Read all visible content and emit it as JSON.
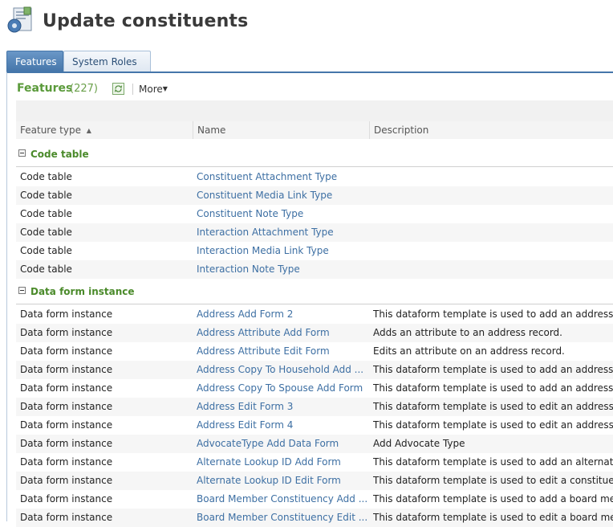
{
  "header": {
    "title": "Update constituents",
    "icon": "constituent-update-icon"
  },
  "tabs": [
    {
      "label": "Features",
      "active": true
    },
    {
      "label": "System Roles",
      "active": false
    }
  ],
  "toolbar": {
    "title": "Features",
    "count": "(227)",
    "refresh_icon": "refresh-icon",
    "more_label": "More"
  },
  "columns": {
    "type": "Feature type",
    "name": "Name",
    "description": "Description"
  },
  "groups": [
    {
      "label": "Code table",
      "rows": [
        {
          "type": "Code table",
          "name": "Constituent Attachment Type",
          "description": ""
        },
        {
          "type": "Code table",
          "name": "Constituent Media Link Type",
          "description": ""
        },
        {
          "type": "Code table",
          "name": "Constituent Note Type",
          "description": ""
        },
        {
          "type": "Code table",
          "name": "Interaction Attachment Type",
          "description": ""
        },
        {
          "type": "Code table",
          "name": "Interaction Media Link Type",
          "description": ""
        },
        {
          "type": "Code table",
          "name": "Interaction Note Type",
          "description": ""
        }
      ]
    },
    {
      "label": "Data form instance",
      "rows": [
        {
          "type": "Data form instance",
          "name": "Address Add Form 2",
          "description": "This dataform template is used to add an address."
        },
        {
          "type": "Data form instance",
          "name": "Address Attribute Add Form",
          "description": "Adds an attribute to an address record."
        },
        {
          "type": "Data form instance",
          "name": "Address Attribute Edit Form",
          "description": "Edits an attribute on an address record."
        },
        {
          "type": "Data form instance",
          "name": "Address Copy To Household Add ...",
          "description": "This dataform template is used to add an address."
        },
        {
          "type": "Data form instance",
          "name": "Address Copy To Spouse Add Form",
          "description": "This dataform template is used to add an address."
        },
        {
          "type": "Data form instance",
          "name": "Address Edit Form 3",
          "description": "This dataform template is used to edit an address."
        },
        {
          "type": "Data form instance",
          "name": "Address Edit Form 4",
          "description": "This dataform template is used to edit an address."
        },
        {
          "type": "Data form instance",
          "name": "AdvocateType Add Data Form",
          "description": "Add Advocate Type"
        },
        {
          "type": "Data form instance",
          "name": "Alternate Lookup ID Add Form",
          "description": "This dataform template is used to add an alternate"
        },
        {
          "type": "Data form instance",
          "name": "Alternate Lookup ID Edit Form",
          "description": "This dataform template is used to edit a constituent"
        },
        {
          "type": "Data form instance",
          "name": "Board Member Constituency Add ...",
          "description": "This dataform template is used to add a board mem"
        },
        {
          "type": "Data form instance",
          "name": "Board Member Constituency Edit ...",
          "description": "This dataform template is used to edit a board mem"
        }
      ]
    }
  ]
}
